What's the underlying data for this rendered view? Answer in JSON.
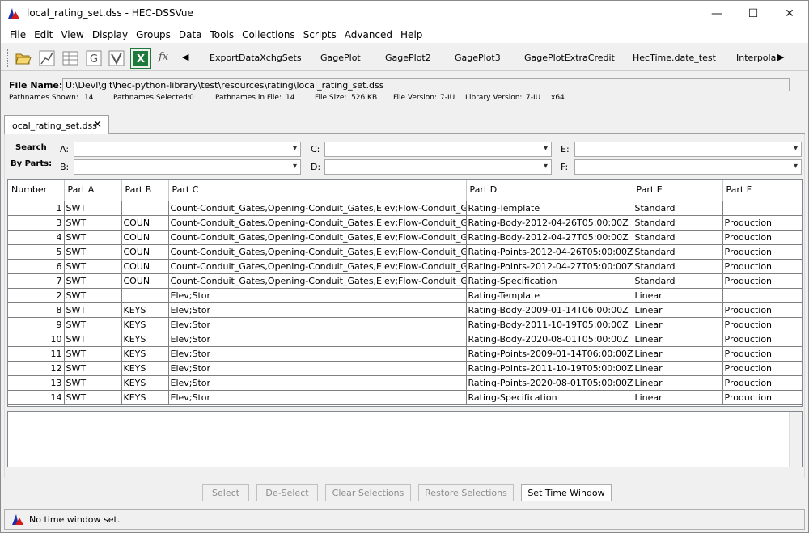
{
  "window": {
    "title": "local_rating_set.dss - HEC-DSSVue",
    "minimize": "—",
    "maximize": "☐",
    "close": "✕"
  },
  "menu": [
    "File",
    "Edit",
    "View",
    "Display",
    "Groups",
    "Data",
    "Tools",
    "Collections",
    "Scripts",
    "Advanced",
    "Help"
  ],
  "toolbar": {
    "scripts": [
      "ExportDataXchgSets",
      "GagePlot",
      "GagePlot2",
      "GagePlot3",
      "GagePlotExtraCredit",
      "HecTime.date_test",
      "Interpola"
    ],
    "fx": "fx",
    "left_arrow": "◀",
    "right_arrow": "▶"
  },
  "file": {
    "label": "File Name:",
    "path": "U:\\Devl\\git\\hec-python-library\\test\\resources\\rating\\local_rating_set.dss"
  },
  "stats": {
    "shown_label": "Pathnames Shown:",
    "shown": "14",
    "selected_label": "Pathnames Selected:",
    "selected": "0",
    "in_file_label": "Pathnames in File:",
    "in_file": "14",
    "size_label": "File Size:",
    "size": "526  KB",
    "version_label": "File Version:",
    "version": "7-IU",
    "lib_label": "Library Version:",
    "lib": "7-IU",
    "arch": "x64"
  },
  "tab": {
    "label": "local_rating_set.dss",
    "close": "✕"
  },
  "search": {
    "title_line1": "Search",
    "title_line2": "By Parts:",
    "labels": {
      "a": "A:",
      "b": "B:",
      "c": "C:",
      "d": "D:",
      "e": "E:",
      "f": "F:"
    }
  },
  "table": {
    "columns": [
      "Number",
      "Part A",
      "Part B",
      "Part C",
      "Part D",
      "Part E",
      "Part F"
    ],
    "sort_caret": "^",
    "rows": [
      [
        "1",
        "SWT",
        "",
        "Count-Conduit_Gates,Opening-Conduit_Gates,Elev;Flow-Conduit_Gates",
        "Rating-Template",
        "Standard",
        ""
      ],
      [
        "3",
        "SWT",
        "COUN",
        "Count-Conduit_Gates,Opening-Conduit_Gates,Elev;Flow-Conduit_Gates",
        "Rating-Body-2012-04-26T05:00:00Z",
        "Standard",
        "Production"
      ],
      [
        "4",
        "SWT",
        "COUN",
        "Count-Conduit_Gates,Opening-Conduit_Gates,Elev;Flow-Conduit_Gates",
        "Rating-Body-2012-04-27T05:00:00Z",
        "Standard",
        "Production"
      ],
      [
        "5",
        "SWT",
        "COUN",
        "Count-Conduit_Gates,Opening-Conduit_Gates,Elev;Flow-Conduit_Gates",
        "Rating-Points-2012-04-26T05:00:00Z",
        "Standard",
        "Production"
      ],
      [
        "6",
        "SWT",
        "COUN",
        "Count-Conduit_Gates,Opening-Conduit_Gates,Elev;Flow-Conduit_Gates",
        "Rating-Points-2012-04-27T05:00:00Z",
        "Standard",
        "Production"
      ],
      [
        "7",
        "SWT",
        "COUN",
        "Count-Conduit_Gates,Opening-Conduit_Gates,Elev;Flow-Conduit_Gates",
        "Rating-Specification",
        "Standard",
        "Production"
      ],
      [
        "2",
        "SWT",
        "",
        "Elev;Stor",
        "Rating-Template",
        "Linear",
        ""
      ],
      [
        "8",
        "SWT",
        "KEYS",
        "Elev;Stor",
        "Rating-Body-2009-01-14T06:00:00Z",
        "Linear",
        "Production"
      ],
      [
        "9",
        "SWT",
        "KEYS",
        "Elev;Stor",
        "Rating-Body-2011-10-19T05:00:00Z",
        "Linear",
        "Production"
      ],
      [
        "10",
        "SWT",
        "KEYS",
        "Elev;Stor",
        "Rating-Body-2020-08-01T05:00:00Z",
        "Linear",
        "Production"
      ],
      [
        "11",
        "SWT",
        "KEYS",
        "Elev;Stor",
        "Rating-Points-2009-01-14T06:00:00Z",
        "Linear",
        "Production"
      ],
      [
        "12",
        "SWT",
        "KEYS",
        "Elev;Stor",
        "Rating-Points-2011-10-19T05:00:00Z",
        "Linear",
        "Production"
      ],
      [
        "13",
        "SWT",
        "KEYS",
        "Elev;Stor",
        "Rating-Points-2020-08-01T05:00:00Z",
        "Linear",
        "Production"
      ],
      [
        "14",
        "SWT",
        "KEYS",
        "Elev;Stor",
        "Rating-Specification",
        "Linear",
        "Production"
      ]
    ]
  },
  "buttons": {
    "select": "Select",
    "deselect": "De-Select",
    "clear": "Clear Selections",
    "restore": "Restore Selections",
    "time_window": "Set Time Window"
  },
  "status": {
    "text": "No time window set."
  },
  "colors": {
    "accent_red": "#d41a1a",
    "accent_blue": "#1a2fb0",
    "excel_green": "#1e7a3a"
  }
}
